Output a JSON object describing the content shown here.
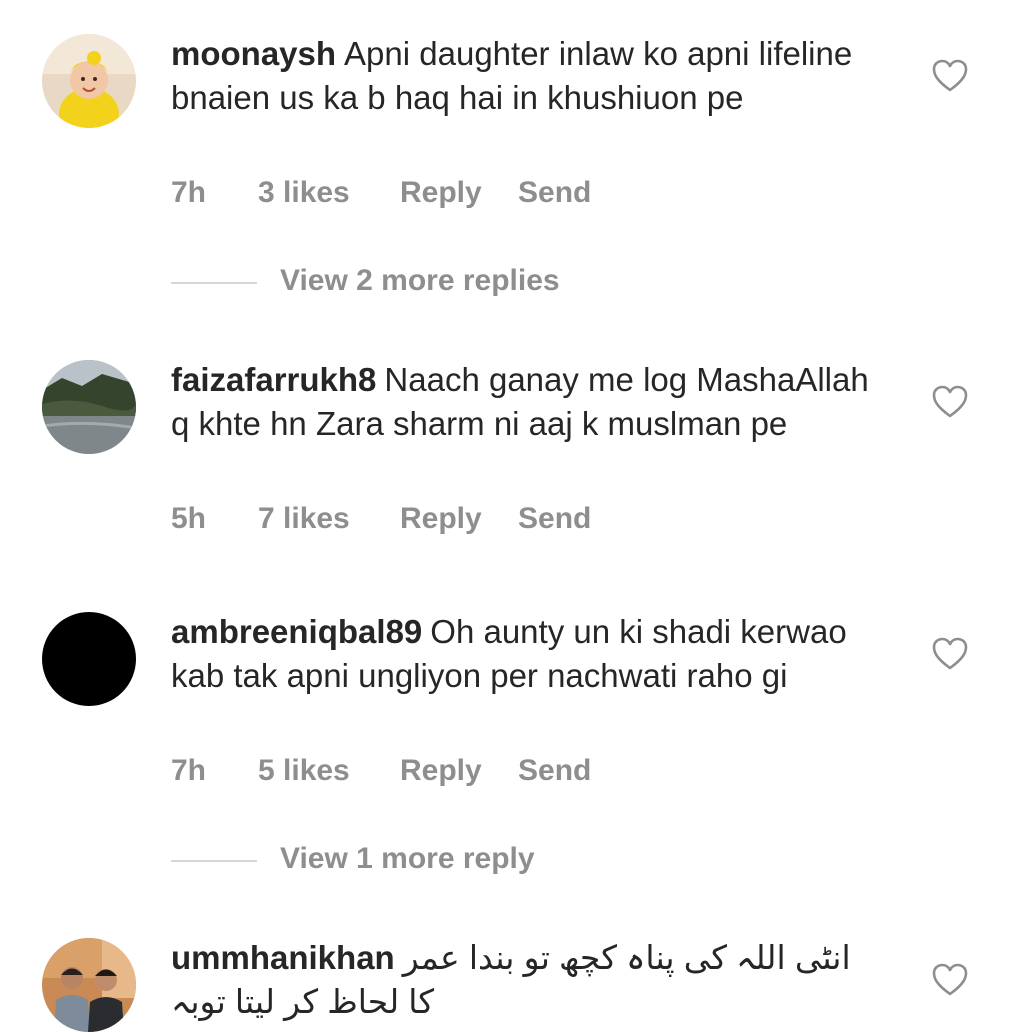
{
  "comments": [
    {
      "username": "moonaysh",
      "text": "Apni daughter inlaw ko apni lifeline bnaien us ka b haq hai in khushiuon pe",
      "time": "7h",
      "likes": "3 likes",
      "reply_label": "Reply",
      "send_label": "Send",
      "view_replies": "View 2 more replies",
      "avatar": "baby-photo-avatar"
    },
    {
      "username": "faizafarrukh8",
      "text": "Naach ganay me log MashaAllah q khte hn Zara sharm ni aaj k muslman pe",
      "time": "5h",
      "likes": "7 likes",
      "reply_label": "Reply",
      "send_label": "Send",
      "avatar": "river-landscape-avatar"
    },
    {
      "username": "ambreeniqbal89",
      "text": "Oh aunty un ki shadi kerwao kab tak apni ungliyon per nachwati raho gi",
      "time": "7h",
      "likes": "5 likes",
      "reply_label": "Reply",
      "send_label": "Send",
      "view_replies": "View 1 more reply",
      "avatar": "black-avatar"
    },
    {
      "username": "ummhanikhan",
      "text": "انٹی اللہ کی پناہ کچھ تو بندا عمر کا لحاظ کر لیتا توبہ",
      "avatar": "two-men-photo-avatar"
    }
  ],
  "icons": {
    "like": "heart-outline-icon"
  },
  "colors": {
    "text": "#262626",
    "secondary": "#8e8e8e",
    "divider": "#d6d6d6",
    "background": "#ffffff"
  }
}
